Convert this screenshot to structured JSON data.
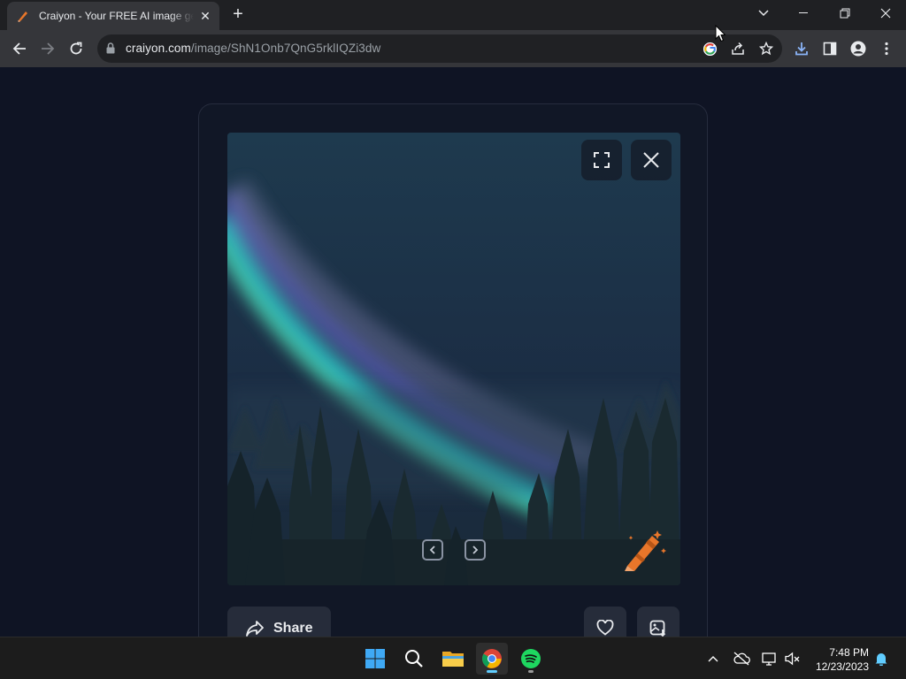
{
  "browser": {
    "tab_title": "Craiyon - Your FREE AI image generator",
    "url_domain": "craiyon.com",
    "url_path": "/image/ShN1Onb7QnG5rklIQZi3dw"
  },
  "page": {
    "share_label": "Share"
  },
  "taskbar": {
    "time": "7:48 PM",
    "date": "12/23/2023"
  },
  "colors": {
    "page_bg": "#0f1424",
    "accent_orange": "#e8762a",
    "button_bg": "#262c3a"
  }
}
